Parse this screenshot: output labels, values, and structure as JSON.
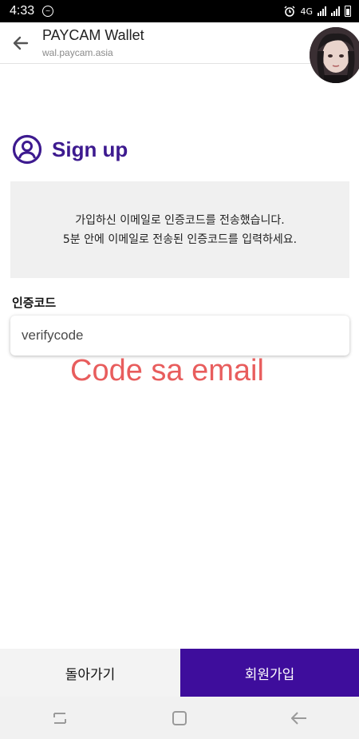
{
  "status_bar": {
    "time": "4:33",
    "network": "4G"
  },
  "browser": {
    "title": "PAYCAM Wallet",
    "url": "wal.paycam.asia"
  },
  "signup": {
    "title": "Sign up",
    "notice_line1": "가입하신 이메일로 인증코드를 전송했습니다.",
    "notice_line2": "5분 안에 이메일로 전송된 인증코드를 입력하세요.",
    "code_label": "인증코드",
    "code_placeholder": "verifycode",
    "code_value": ""
  },
  "annotation": "Code sa email",
  "buttons": {
    "back": "돌아가기",
    "signup": "회원가입"
  },
  "colors": {
    "accent": "#3d1a8f",
    "primary_button": "#3e0d9c",
    "annotation": "#e85d5d"
  }
}
